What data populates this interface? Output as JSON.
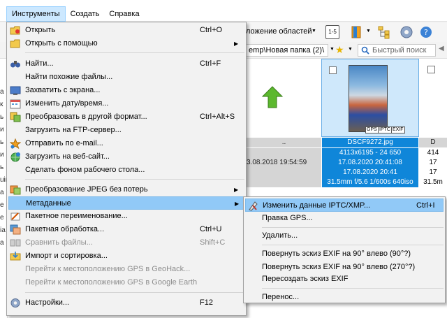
{
  "menubar": {
    "items": [
      "Инструменты",
      "Создать",
      "Справка"
    ]
  },
  "toolbar": {
    "layout_label": "ложение областей",
    "badge": "1-5"
  },
  "address": {
    "path": "emp\\Новая папка (2)\\",
    "search_placeholder": "Быстрый поиск"
  },
  "file": {
    "name": "DSCF9272.jpg",
    "dimensions": "4113x6195 - 24 650",
    "date1": "17.08.2020 20:41:08",
    "date2": "17.08.2020 20:41",
    "exposure": "31.5mm f/5.6 1/600s 640iso",
    "badges": [
      "GPS",
      "IPTC",
      "EXIF"
    ],
    "parent_label": "..",
    "parent_date": "3.08.2018 19:54:59",
    "right_col": [
      "D",
      "414",
      "17",
      "17",
      "31.5m"
    ]
  },
  "main_menu": {
    "items": [
      {
        "label": "Открыть",
        "shortcut": "Ctrl+O",
        "arrow": ""
      },
      {
        "label": "Открыть с помощью",
        "shortcut": "",
        "arrow": "▶"
      },
      {
        "label": "Найти...",
        "shortcut": "Ctrl+F",
        "arrow": ""
      },
      {
        "label": "Найти похожие файлы...",
        "shortcut": "",
        "arrow": ""
      },
      {
        "label": "Захватить с экрана...",
        "shortcut": "",
        "arrow": ""
      },
      {
        "label": "Изменить дату/время...",
        "shortcut": "",
        "arrow": ""
      },
      {
        "label": "Преобразовать в другой формат...",
        "shortcut": "Ctrl+Alt+S",
        "arrow": ""
      },
      {
        "label": "Загрузить на FTP-сервер...",
        "shortcut": "",
        "arrow": ""
      },
      {
        "label": "Отправить по e-mail...",
        "shortcut": "",
        "arrow": ""
      },
      {
        "label": "Загрузить на веб-сайт...",
        "shortcut": "",
        "arrow": ""
      },
      {
        "label": "Сделать фоном рабочего стола...",
        "shortcut": "",
        "arrow": ""
      },
      {
        "label": "Преобразование JPEG без потерь",
        "shortcut": "",
        "arrow": "▶"
      },
      {
        "label": "Метаданные",
        "shortcut": "",
        "arrow": "▶"
      },
      {
        "label": "Пакетное переименование...",
        "shortcut": "",
        "arrow": ""
      },
      {
        "label": "Пакетная обработка...",
        "shortcut": "Ctrl+U",
        "arrow": ""
      },
      {
        "label": "Сравнить файлы...",
        "shortcut": "Shift+C",
        "arrow": ""
      },
      {
        "label": "Импорт и сортировка...",
        "shortcut": "",
        "arrow": ""
      },
      {
        "label": "Перейти к местоположению GPS в GeoHack...",
        "shortcut": "",
        "arrow": ""
      },
      {
        "label": "Перейти к местоположению GPS в Google Earth",
        "shortcut": "",
        "arrow": ""
      },
      {
        "label": "Настройки...",
        "shortcut": "F12",
        "arrow": ""
      }
    ]
  },
  "sub_menu": {
    "items": [
      {
        "label": "Изменить данные IPTC/XMP...",
        "shortcut": "Ctrl+I"
      },
      {
        "label": "Правка GPS...",
        "shortcut": ""
      },
      {
        "label": "Удалить...",
        "shortcut": ""
      },
      {
        "label": "Повернуть эскиз EXIF на 90° влево (90°?)",
        "shortcut": ""
      },
      {
        "label": "Повернуть эскиз EXIF на 90° влево (270°?)",
        "shortcut": ""
      },
      {
        "label": "Пересоздать эскиз EXIF",
        "shortcut": ""
      },
      {
        "label": "Перенос...",
        "shortcut": ""
      }
    ]
  },
  "left_panel": [
    "а",
    "к",
    "ь",
    "и",
    "ь",
    "и",
    "ь",
    "uir",
    "а",
    "е",
    "е",
    "ia",
    "а"
  ],
  "colors": {
    "menu_bg": "#f2f2f2",
    "highlight": "#91c9f7",
    "selection": "#0f86d9",
    "disabled_text": "#8d8d8d"
  }
}
